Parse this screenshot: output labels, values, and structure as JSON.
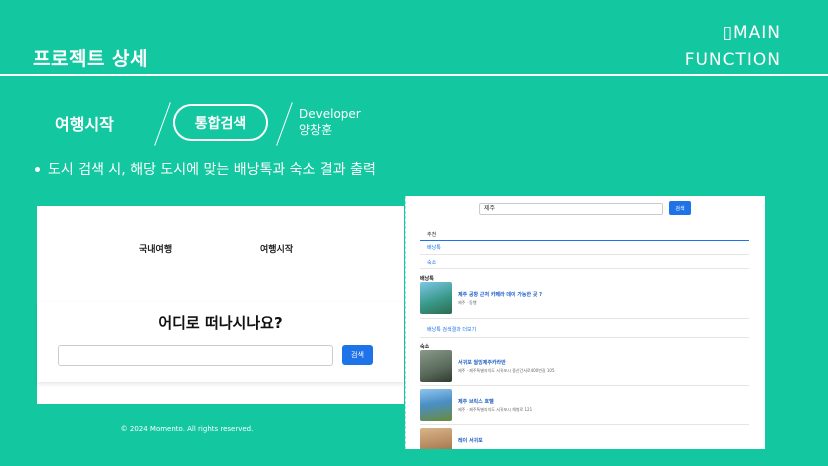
{
  "header": {
    "title": "프로젝트 상세",
    "main_function_line1": "▯MAIN",
    "main_function_line2": "FUNCTION"
  },
  "steps": {
    "step1": "여행시작",
    "step2": "통합검색",
    "role": "Developer",
    "developer_name": "양창훈"
  },
  "description": "도시 검색 시, 해당 도시에 맞는 배낭톡과 숙소 결과 출력",
  "left_screen": {
    "nav_domestic": "국내여행",
    "nav_start": "여행시작",
    "question": "어디로 떠나시나요?",
    "search_button": "검색",
    "footer": "© 2024 Momento. All rights reserved."
  },
  "right_screen": {
    "search_value": "제주",
    "search_button": "검색",
    "tabs": [
      "추천",
      "배낭톡",
      "숙소"
    ],
    "backpack_section": "배낭톡",
    "backpack_items": [
      {
        "title": "제주 공항 근처 카페라 데이 가능한 곳 ?",
        "sub": "제주 · 동행",
        "color": "#3a9a8a"
      }
    ],
    "more_link": "배낭톡 검색결과 더보기",
    "lodging_section": "숙소",
    "lodging_items": [
      {
        "title": "서귀포 웜밍제주카라반",
        "sub": "제주 · 제주특별자치도 서귀포시 중산간서로400번길 105",
        "color": "#5a6a5a"
      },
      {
        "title": "제주 브릭스 호텔",
        "sub": "제주 · 제주특별자치도 서귀포시 해병로 121",
        "color": "#4a8fc7"
      },
      {
        "title": "레이 서귀포",
        "sub": "",
        "color": "#b0835a"
      }
    ]
  }
}
